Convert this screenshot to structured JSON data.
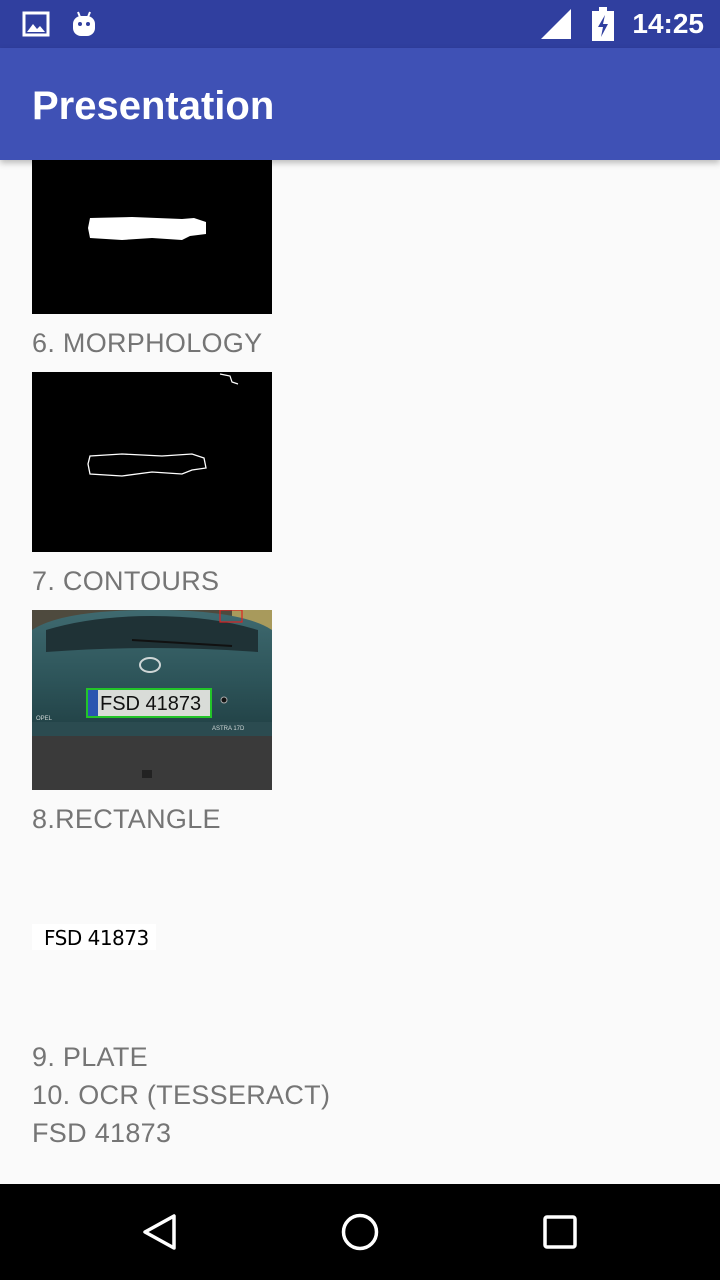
{
  "status_bar": {
    "time": "14:25",
    "icons": [
      "image-notification-icon",
      "android-debug-icon",
      "signal-icon",
      "battery-charging-icon"
    ]
  },
  "app_bar": {
    "title": "Presentation"
  },
  "steps": {
    "morphology": "6. MORPHOLOGY",
    "contours": "7. CONTOURS",
    "rectangle": "8.RECTANGLE",
    "plate_image_text": "FSD 41873",
    "rectangle_image_plate_text": "FSD 41873",
    "plate": "9. PLATE",
    "ocr": "10. OCR (TESSERACT)",
    "ocr_result": "FSD 41873"
  },
  "navigation": {
    "buttons": [
      "back-icon",
      "home-icon",
      "recents-icon"
    ]
  },
  "colors": {
    "status_bar": "#303f9f",
    "app_bar": "#3f51b5",
    "caption_text": "#757575",
    "background": "#fafafa"
  }
}
